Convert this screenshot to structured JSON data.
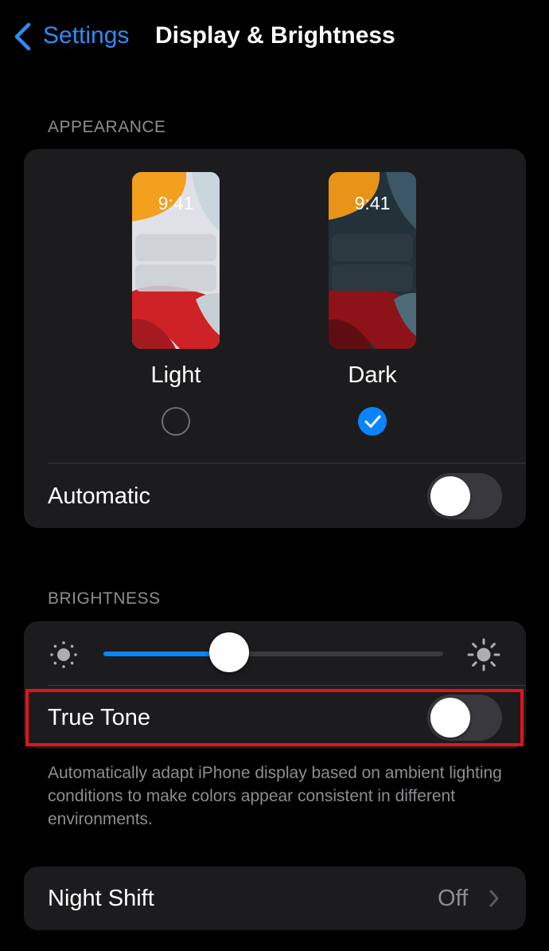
{
  "nav": {
    "back_label": "Settings",
    "title": "Display & Brightness"
  },
  "appearance": {
    "header": "APPEARANCE",
    "options": [
      {
        "label": "Light",
        "time": "9:41",
        "selected": false
      },
      {
        "label": "Dark",
        "time": "9:41",
        "selected": true
      }
    ],
    "automatic_label": "Automatic",
    "automatic_on": false
  },
  "brightness": {
    "header": "BRIGHTNESS",
    "level": 0.37,
    "true_tone_label": "True Tone",
    "true_tone_on": false,
    "true_tone_footer": "Automatically adapt iPhone display based on ambient lighting conditions to make colors appear consistent in different environments."
  },
  "night_shift": {
    "label": "Night Shift",
    "value": "Off"
  },
  "colors": {
    "accent": "#0a84ff",
    "link": "#2f8cf4",
    "highlight": "#e0141b"
  }
}
